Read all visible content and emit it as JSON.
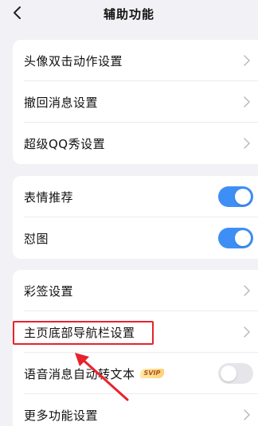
{
  "nav": {
    "title": "辅助功能",
    "back_icon": "chevron-left-icon"
  },
  "group1": {
    "items": [
      {
        "label": "头像双击动作设置"
      },
      {
        "label": "撤回消息设置"
      },
      {
        "label": "超级QQ秀设置"
      }
    ]
  },
  "group2": {
    "items": [
      {
        "label": "表情推荐",
        "toggle": true
      },
      {
        "label": "怼图",
        "toggle": true
      }
    ]
  },
  "group3": {
    "items": [
      {
        "label": "彩签设置"
      },
      {
        "label": "主页底部导航栏设置"
      },
      {
        "label": "语音消息自动转文本",
        "badge": "SVIP",
        "toggle": false
      },
      {
        "label": "更多功能设置"
      }
    ]
  },
  "colors": {
    "background": "#f2f2f6",
    "toggle_on": "#3d8ff6",
    "toggle_off": "#e6e6ea",
    "highlight": "#e8222c"
  }
}
